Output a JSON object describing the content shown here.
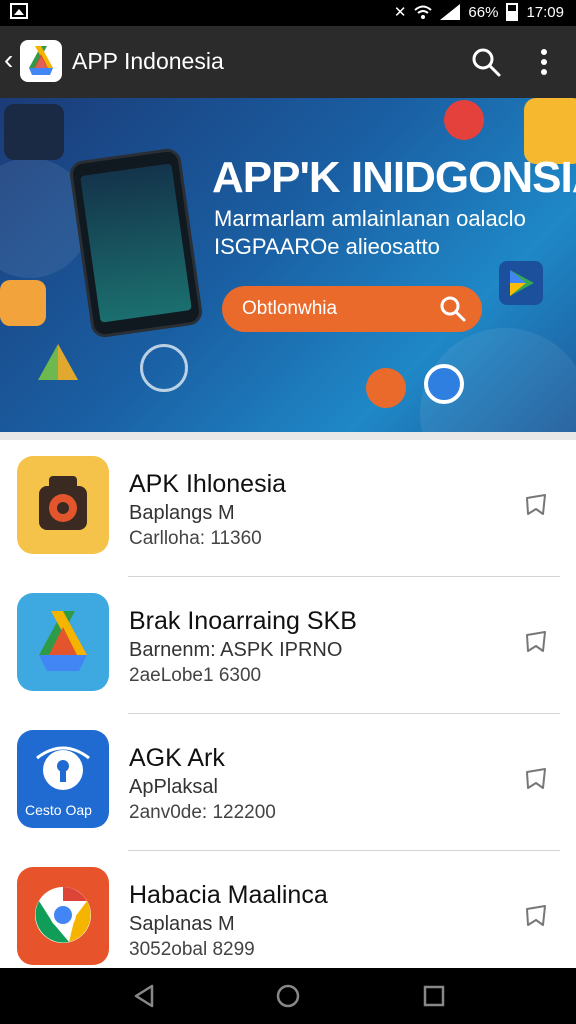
{
  "status_bar": {
    "battery": "66%",
    "time": "17:09"
  },
  "app_bar": {
    "title": "APP Indonesia"
  },
  "banner": {
    "heading": "APP'K INIDGONSIA",
    "subtitle_line1": "Marmarlam amlainlanan oalaclo",
    "subtitle_line2": "ISGPAAROe alieosatto",
    "search_text": "Obtlonwhia"
  },
  "apps": [
    {
      "title": "APK Ihlonesia",
      "subtitle": "Baplangs M",
      "meta": "Carlloha: 11360",
      "icon": "camera-app-icon",
      "icon_color": "#f5c24a"
    },
    {
      "title": "Brak Inoarraing SKB",
      "subtitle": "Barnenm: ASPK IPRNO",
      "meta": "2aeLobe1 6300",
      "icon": "drive-app-icon",
      "icon_color": "#3ea9e0"
    },
    {
      "title": "AGK Ark",
      "subtitle": "ApPlaksal",
      "meta": "2anv0de: 122200",
      "icon": "security-app-icon",
      "icon_color": "#1f6bd1",
      "icon_label": "Cesto Oap"
    },
    {
      "title": "Habacia Maalinca",
      "subtitle": "Saplanas M",
      "meta": "3052obal 8299",
      "icon": "chrome-app-icon",
      "icon_color": "#e7542b"
    }
  ],
  "colors": {
    "appbar": "#2b2b2b",
    "accent": "#ea6a2c",
    "banner": "#1a5fa3"
  }
}
